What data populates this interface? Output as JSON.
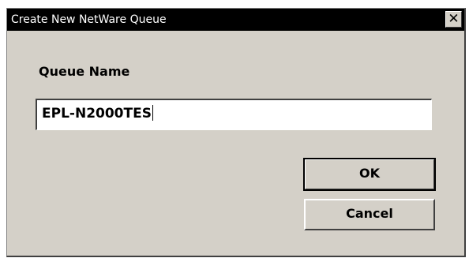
{
  "window": {
    "title": "Create New NetWare Queue",
    "close_symbol": "✕"
  },
  "form": {
    "queue_name_label": "Queue Name",
    "queue_name_value": "EPL-N2000TES"
  },
  "buttons": {
    "ok_label": "OK",
    "cancel_label": "Cancel"
  }
}
